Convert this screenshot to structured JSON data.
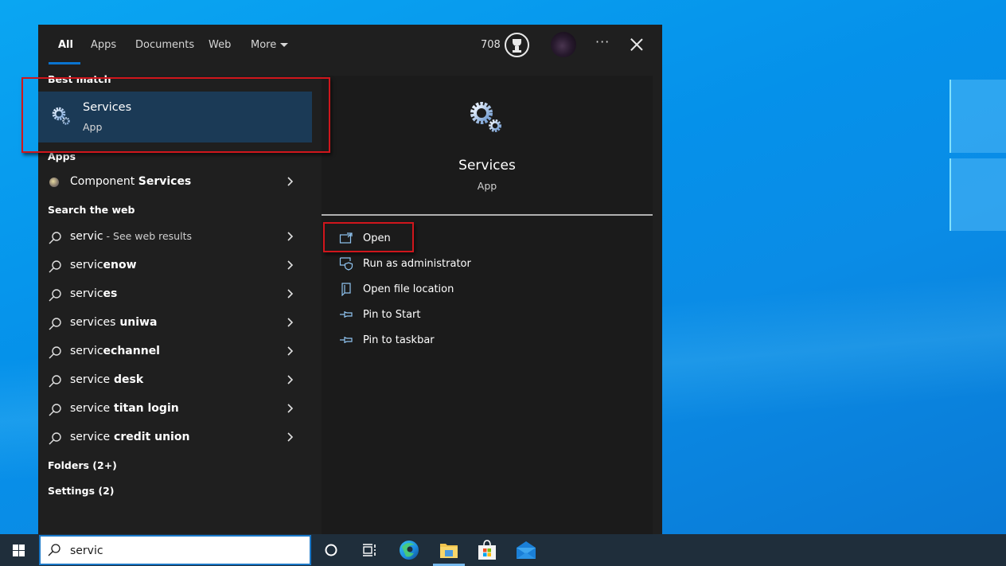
{
  "search_panel": {
    "tabs": [
      {
        "label": "All",
        "active": true
      },
      {
        "label": "Apps",
        "active": false
      },
      {
        "label": "Documents",
        "active": false
      },
      {
        "label": "Web",
        "active": false
      },
      {
        "label": "More",
        "active": false
      }
    ],
    "rewards_points": "708",
    "more_options_label": "···"
  },
  "results": {
    "best_match_heading": "Best match",
    "best_match": {
      "title": "Services",
      "subtitle": "App",
      "icon": "gears-icon"
    },
    "apps_heading": "Apps",
    "apps": [
      {
        "prefix": "Component ",
        "match": "Services",
        "suffix": "",
        "icon": "component-services-icon"
      }
    ],
    "web_heading": "Search the web",
    "web_results": [
      {
        "typed": "servic",
        "completion": "",
        "hint": " - See web results"
      },
      {
        "typed": "servic",
        "completion": "enow",
        "hint": ""
      },
      {
        "typed": "servic",
        "completion": "es",
        "hint": ""
      },
      {
        "typed": "services",
        "completion": " uniwa",
        "hint": ""
      },
      {
        "typed": "servic",
        "completion": "echannel",
        "hint": ""
      },
      {
        "typed": "service",
        "completion": " desk",
        "hint": ""
      },
      {
        "typed": "service",
        "completion": " titan login",
        "hint": ""
      },
      {
        "typed": "service",
        "completion": " credit union",
        "hint": ""
      }
    ],
    "folders_heading": "Folders (2+)",
    "settings_heading": "Settings (2)"
  },
  "details": {
    "app_name": "Services",
    "app_type": "App",
    "actions": [
      {
        "label": "Open",
        "icon": "open-icon"
      },
      {
        "label": "Run as administrator",
        "icon": "run-as-admin-icon"
      },
      {
        "label": "Open file location",
        "icon": "file-location-icon"
      },
      {
        "label": "Pin to Start",
        "icon": "pin-icon"
      },
      {
        "label": "Pin to taskbar",
        "icon": "pin-icon"
      }
    ]
  },
  "taskbar": {
    "search_query": "servic",
    "pinned_apps": [
      "Cortana",
      "Task View",
      "Microsoft Edge",
      "File Explorer",
      "Microsoft Store",
      "Mail"
    ],
    "active_app": "File Explorer"
  },
  "colors": {
    "accent": "#0a74d0",
    "highlight_box": "#d0161c",
    "selected_row": "#1b3a56"
  }
}
